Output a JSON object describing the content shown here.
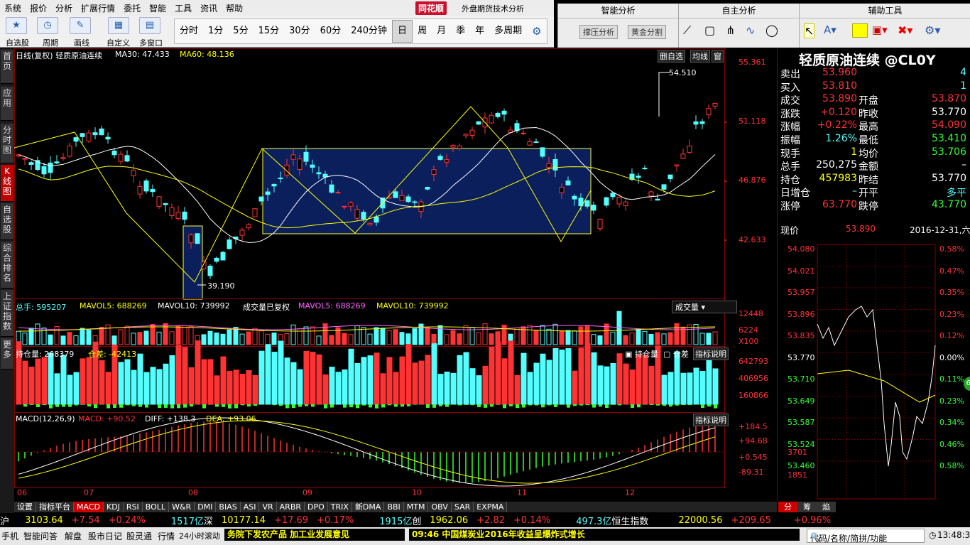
{
  "menu": {
    "items": [
      "系统",
      "报价",
      "分析",
      "扩展行情",
      "委托",
      "智能",
      "工具",
      "资讯",
      "帮助"
    ],
    "brand": "同花顺",
    "app_title": "外盘期货技术分析"
  },
  "toolbar": {
    "labels": [
      "自选股",
      "周期",
      "画线",
      "自定义",
      "多窗口"
    ],
    "periods": [
      "分时",
      "1分",
      "5分",
      "15分",
      "30分",
      "60分",
      "240分钟",
      "日",
      "周",
      "月",
      "季",
      "年",
      "多周期"
    ],
    "selected_period": "日"
  },
  "right_toolbar": {
    "smart_analysis": "智能分析",
    "independent_analysis": "自主分析",
    "aux_tools": "辅助工具",
    "btn_support": "撑压分析",
    "btn_golden": "黄金分割"
  },
  "sidebar": [
    "首页",
    "应用",
    "分时图",
    "K线图",
    "自选股",
    "综合排名",
    "上证指数",
    "更多"
  ],
  "chart_header": {
    "title": "日线(复权)  轻质原油连续",
    "ma30": "MA30: 47.433",
    "ma60": "MA60: 48.136",
    "btn_del": "删自选",
    "btn_ma": "均线",
    "btn_win": "窗"
  },
  "price_axis": [
    "55.361",
    "51.118",
    "46.876",
    "42.633"
  ],
  "annotations": {
    "high": "54.510",
    "low": "39.190"
  },
  "volume_panel": {
    "label_total": "总手: 595207",
    "mavol5": "MAVOL5: 688269",
    "mavol10": "MAVOL10: 739992",
    "label2": "成交量已复权",
    "mavol5b": "MAVOL5: 688269",
    "mavol10b": "MAVOL10: 739992",
    "dropdown": "成交量",
    "axis": [
      "12448",
      "6224",
      "X100"
    ]
  },
  "oi_panel": {
    "label": "持仓量: 268379",
    "diff": "仓差: -42413",
    "legend1": "持仓量",
    "legend2": "仓差",
    "explain": "指标说明",
    "axis": [
      "642793",
      "406956",
      "160866"
    ]
  },
  "macd_panel": {
    "label": "MACD(12,26,9)",
    "macd": "MACD: +90.52",
    "diff": "DIFF: +138.3",
    "dea": "DEA: +93.06",
    "explain": "指标说明",
    "axis": [
      "+184.5",
      "+94.68",
      "+0.545",
      "-89.31"
    ]
  },
  "months": [
    "06",
    "07",
    "08",
    "09",
    "10",
    "11",
    "12"
  ],
  "quote": {
    "title": "轻质原油连续 @CL0Y",
    "rows": [
      {
        "l1": "卖出",
        "v1": "53.960",
        "l2": "",
        "v2": "4"
      },
      {
        "l1": "买入",
        "v1": "53.810",
        "l2": "",
        "v2": "1"
      },
      {
        "l1": "成交",
        "v1": "53.890",
        "l2": "开盘",
        "v2": "53.870"
      },
      {
        "l1": "涨跌",
        "v1": "+0.120",
        "l2": "昨收",
        "v2": "53.770"
      },
      {
        "l1": "涨幅",
        "v1": "+0.22%",
        "l2": "最高",
        "v2": "54.090"
      },
      {
        "l1": "振幅",
        "v1": "1.26%",
        "l2": "最低",
        "v2": "53.410"
      },
      {
        "l1": "现手",
        "v1": "1",
        "l2": "均价",
        "v2": "53.706"
      },
      {
        "l1": "总手",
        "v1": "250,275",
        "l2": "金额",
        "v2": "–"
      },
      {
        "l1": "持仓",
        "v1": "457983",
        "l2": "昨结",
        "v2": "53.770"
      },
      {
        "l1": "日增仓",
        "v1": "–",
        "l2": "开平",
        "v2": "多平"
      },
      {
        "l1": "涨停",
        "v1": "63.770",
        "l2": "跌停",
        "v2": "43.770"
      }
    ],
    "now_label": "现价",
    "now_price": "53.890",
    "date": "2016-12-31,六",
    "mini_left": [
      "54.080",
      "54.021",
      "53.957",
      "53.896",
      "53.835",
      "53.770",
      "53.710",
      "53.649",
      "53.587",
      "53.524",
      "53.460",
      "3701",
      "1851"
    ],
    "mini_right": [
      "0.58%",
      "0.47%",
      "0.35%",
      "0.23%",
      "0.12%",
      "0.00%",
      "0.11%",
      "0.23%",
      "0.34%",
      "0.46%",
      "0.58%"
    ],
    "tabs": [
      "分",
      "筹",
      "焰"
    ],
    "badge": "63"
  },
  "bottom_tabs": [
    "设置",
    "指标平台",
    "MACD",
    "KDJ",
    "RSI",
    "BOLL",
    "W&R",
    "DMI",
    "BIAS",
    "ASI",
    "VR",
    "ARBR",
    "DPO",
    "TRIX",
    "新DMA",
    "BBI",
    "MTM",
    "OBV",
    "SAR",
    "EXPMA"
  ],
  "ticker": {
    "sh": "沪",
    "sh_val": "3103.64",
    "sh_chg": "+7.54",
    "sh_pct": "+0.24%",
    "sh_amt": "1517亿",
    "sz": "深",
    "sz_val": "10177.14",
    "sz_chg": "+17.69",
    "sz_pct": "+0.17%",
    "sz_amt": "1915亿",
    "cy": "创",
    "cy_val": "1962.06",
    "cy_chg": "+2.82",
    "cy_pct": "+0.14%",
    "cy_amt": "497.3亿",
    "hs": "恒生指数",
    "hs_val": "22000.56",
    "hs_chg": "+209.65",
    "hs_pct": "+0.96%"
  },
  "status": {
    "items": [
      "手机",
      "智能问答",
      "解盘",
      "股市日记",
      "股灵通",
      "行情",
      "24小时滚动"
    ],
    "news1": "务院下发农产品 加工业发展意见",
    "news2": "09:46 中国煤炭业2016年收益呈爆炸式增长",
    "search_placeholder": "代码/名称/简拼/功能",
    "clock": "13:48:38"
  },
  "colors": {
    "up": "#ff3333",
    "down": "#54ffff",
    "ma30": "#ffffff",
    "ma60": "#ffff00",
    "box": "#0a1f5c"
  }
}
